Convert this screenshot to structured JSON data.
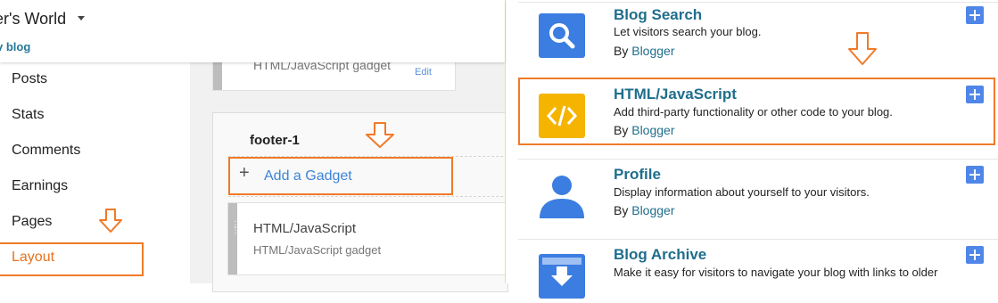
{
  "header": {
    "blog_title": "er's World",
    "view_blog": "v blog"
  },
  "sidebar": {
    "items": [
      {
        "label": "Posts"
      },
      {
        "label": "Stats"
      },
      {
        "label": "Comments"
      },
      {
        "label": "Earnings"
      },
      {
        "label": "Pages"
      },
      {
        "label": "Layout"
      }
    ]
  },
  "layout": {
    "top_gadget": {
      "subtitle": "HTML/JavaScript gadget",
      "edit_label": "Edit"
    },
    "footer_section": {
      "title": "footer-1",
      "add_gadget_label": "Add a Gadget",
      "gadget": {
        "title": "HTML/JavaScript",
        "subtitle": "HTML/JavaScript gadget"
      }
    }
  },
  "gadget_panel": {
    "gadgets": [
      {
        "name": "Blog Search",
        "description": "Let visitors search your blog.",
        "by_label": "By",
        "author": "Blogger",
        "icon": "search-icon",
        "icon_color": "#3b7de0"
      },
      {
        "name": "HTML/JavaScript",
        "description": "Add third-party functionality or other code to your blog.",
        "by_label": "By",
        "author": "Blogger",
        "icon": "code-icon",
        "icon_color": "#f4b400"
      },
      {
        "name": "Profile",
        "description": "Display information about yourself to your visitors.",
        "by_label": "By",
        "author": "Blogger",
        "icon": "person-icon",
        "icon_color": "#3b7de0"
      },
      {
        "name": "Blog Archive",
        "description": "Make it easy for visitors to navigate your blog with links to older",
        "by_label": "",
        "author": "",
        "icon": "archive-icon",
        "icon_color": "#3b7de0"
      }
    ]
  },
  "colors": {
    "highlight": "#f07a28",
    "link": "#1f6e8c",
    "plus_button": "#4f86e8"
  }
}
